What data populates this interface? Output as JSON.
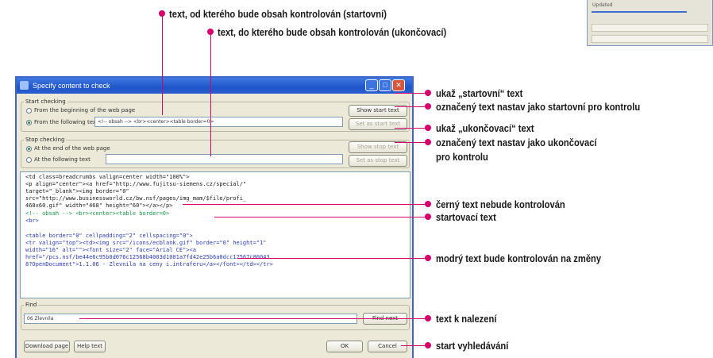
{
  "annotations": {
    "top_start": "text, od kterého bude obsah kontrolován (startovní)",
    "top_end": "text, do kterého bude obsah kontrolován (ukončovací)",
    "show_start": "ukaž „startovní“ text",
    "mark_start": "označený text nastav jako startovní pro kontrolu",
    "show_end": "ukaž „ukončovací“ text",
    "mark_end_line1": "označený text nastav jako ukončovací",
    "mark_end_line2": "pro kontrolu",
    "black_text": "černý text nebude kontrolován",
    "start_text": "startovací text",
    "blue_text": "modrý text bude kontrolován na změny",
    "find_text": "text k nalezení",
    "start_search": "start vyhledávání"
  },
  "colors": {
    "accent": "#d6006f",
    "titlebar": "#2a5fd0",
    "code_green": "#129a45",
    "code_blue": "#2b3cb8"
  },
  "dialog": {
    "title": "Specify content to check",
    "start_group": {
      "label": "Start checking",
      "option_beginning": "From the beginning of the web page",
      "option_following": "From the following text",
      "start_value": "<!-- obsah --> <br><center><table border=0>",
      "show_start_button": "Show start text",
      "set_start_button": "Set as start text"
    },
    "stop_group": {
      "label": "Stop checking",
      "option_end": "At the end of the web page",
      "option_following": "At the following text",
      "stop_value": "",
      "show_stop_button": "Show stop text",
      "set_stop_button": "Set as stop text"
    },
    "code_lines": [
      {
        "text": "                <td class=breadcrumbs valign=center width=\"100%\">",
        "style": "black"
      },
      {
        "text": "<p align=\"center\"><a href=\"http://www.fujitsu-siemens.cz/special/\"",
        "style": "black"
      },
      {
        "text": "target=\"_blank\"><img border=\"0\"",
        "style": "black"
      },
      {
        "text": "src=\"http://www.businessworld.cz/bw.nsf/pages/img_mam/$file/profi_",
        "style": "black"
      },
      {
        "text": "468x60.gif\" width=\"468\" height=\"60\"></a></p>",
        "style": "black"
      },
      {
        "text": "<!-- obsah --> <br><center><table border=0>",
        "style": "green"
      },
      {
        "text": "<br>",
        "style": "blue"
      },
      {
        "text": "",
        "style": "blue"
      },
      {
        "text": "<table border=\"0\" cellpadding=\"2\" cellspacing=\"0\">",
        "style": "blue"
      },
      {
        "text": "<tr valign=\"top\"><td><img src=\"/icons/ecblank.gif\" border=\"0\" height=\"1\"",
        "style": "blue"
      },
      {
        "text": "width=\"16\" alt=\"\"><font size=\"2\" face=\"Arial CE\"><a",
        "style": "blue"
      },
      {
        "text": "href=\"/pcs.nsf/be44e6c95b0d076c12568b4003d1001a7fd42e25b6a0dcc12567c80043",
        "style": "blue"
      },
      {
        "text": "8?OpenDocument\">1.1.06 - Zlevnila na ceny i.intraferu</a></font></td></tr>",
        "style": "blue"
      }
    ],
    "find_group": {
      "label": "Find",
      "value": "06  Zlevnila",
      "find_button": "Find next"
    },
    "download_button": "Download page",
    "help_button": "Help text",
    "ok_button": "OK",
    "cancel_button": "Cancel"
  },
  "corner_window": {
    "label": "Updated"
  }
}
